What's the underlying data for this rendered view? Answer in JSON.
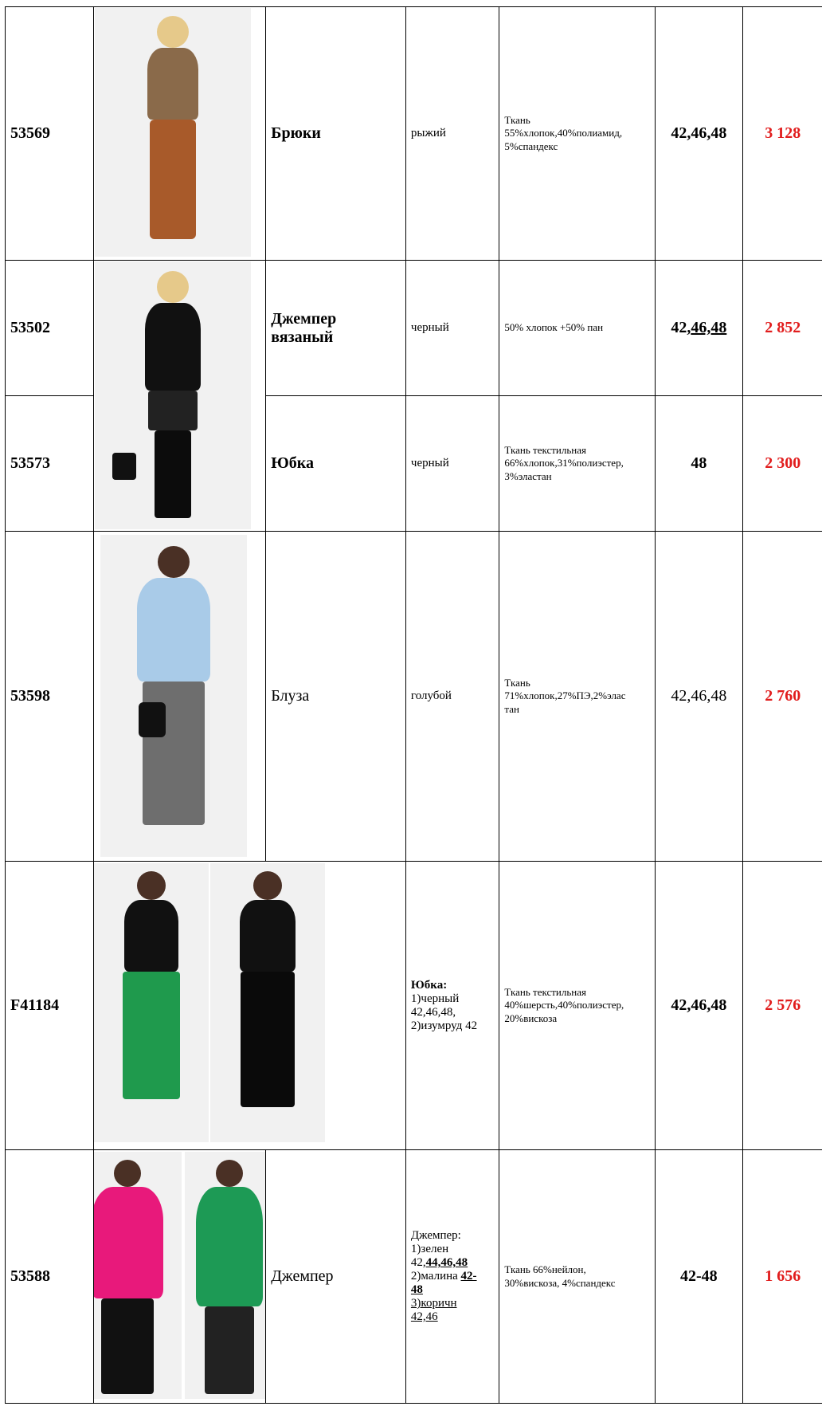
{
  "rows": [
    {
      "code": "53569",
      "name": "Брюки",
      "color": "рыжий",
      "fabric": [
        "Ткань",
        "55%хлопок,40%полиамид,",
        "5%спандекс"
      ],
      "sizes": "42,46,48",
      "price": "3 128"
    },
    {
      "code": "53502",
      "name": "Джемпер вязаный",
      "color": "черный",
      "fabric": [
        "50% хлопок +50% пан"
      ],
      "sizes_plain": "42,",
      "sizes_underlined": "46,48",
      "price": "2 852"
    },
    {
      "code": "53573",
      "name": "Юбка",
      "color": "черный",
      "fabric": [
        "Ткань текстильная",
        "66%хлопок,31%полиэстер,",
        "3%эластан"
      ],
      "sizes": "48",
      "price": "2 300"
    },
    {
      "code": "53598",
      "name": "Блуза",
      "color": "голубой",
      "fabric": [
        "Ткань",
        "71%хлопок,27%ПЭ,2%элас",
        "тан"
      ],
      "sizes": "42,46,48",
      "price": "2 760"
    },
    {
      "code": "F41184",
      "name": "",
      "color_title": "Юбка:",
      "color_lines": [
        "1)черный",
        "42,46,48,",
        "2)изумруд 42"
      ],
      "fabric": [
        "Ткань текстильная",
        "40%шерсть,40%полиэстер,",
        "20%вискоза"
      ],
      "sizes": "42,46,48",
      "price": "2 576"
    },
    {
      "code": "53588",
      "name": "Джемпер",
      "color_title": "Джемпер:",
      "color_l1": "1)зелен",
      "color_l2a": "42,",
      "color_l2b": "44,46,48",
      "color_l3a": "2)малина",
      "color_l3b": "42-",
      "color_l4": "48",
      "color_l5": "3)коричн",
      "color_l6": "42,46",
      "fabric": [
        "Ткань 66%нейлон,",
        "30%вискоза, 4%спандекс"
      ],
      "sizes": "42-48",
      "price": "1 656"
    }
  ],
  "colors": {
    "price": "#e11d1d",
    "border": "#000000"
  }
}
